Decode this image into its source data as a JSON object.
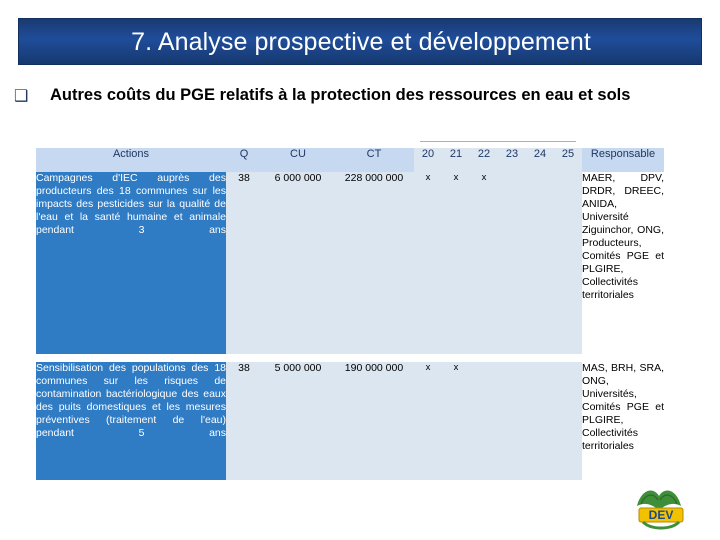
{
  "slide": {
    "title": "7. Analyse prospective et développement",
    "bullet_marker": "❑",
    "heading": "Autres coûts du PGE relatifs à la protection des ressources en eau et sols"
  },
  "table": {
    "headers": {
      "actions": "Actions",
      "q": "Q",
      "cu": "CU",
      "ct": "CT",
      "y20": "20",
      "y21": "21",
      "y22": "22",
      "y23": "23",
      "y24": "24",
      "y25": "25",
      "responsable": "Responsable"
    },
    "rows": [
      {
        "action": "Campagnes d'IEC auprès des producteurs des 18 communes sur les impacts des pesticides sur la qualité de l'eau et la santé humaine et animale pendant 3 ans",
        "q": "38",
        "cu": "6 000 000",
        "ct": "228 000 000",
        "y20": "x",
        "y21": "x",
        "y22": "x",
        "y23": "",
        "y24": "",
        "y25": "",
        "responsable": "MAER, DPV, DRDR, DREEC, ANIDA, Université Ziguinchor, ONG, Producteurs, Comités PGE et PLGIRE, Collectivités territoriales"
      },
      {
        "action": "Sensibilisation des populations des 18 communes sur les risques de contamination bactériologique des eaux des puits domestiques et les mesures préventives (traitement de l'eau) pendant 5 ans",
        "q": "38",
        "cu": "5 000 000",
        "ct": "190 000 000",
        "y20": "x",
        "y21": "x",
        "y22": "",
        "y23": "",
        "y24": "",
        "y25": "",
        "responsable": "MAS, BRH, SRA, ONG, Universités, Comités PGE et PLGIRE, Collectivités territoriales"
      }
    ]
  },
  "logo": {
    "name": "dev-emblem-logo",
    "text": "DEV"
  },
  "colors": {
    "title_banner": "#1f4d9a",
    "action_cell": "#2f7bc4",
    "light_blue": "#dce6f1",
    "header_text": "#1f3864"
  }
}
